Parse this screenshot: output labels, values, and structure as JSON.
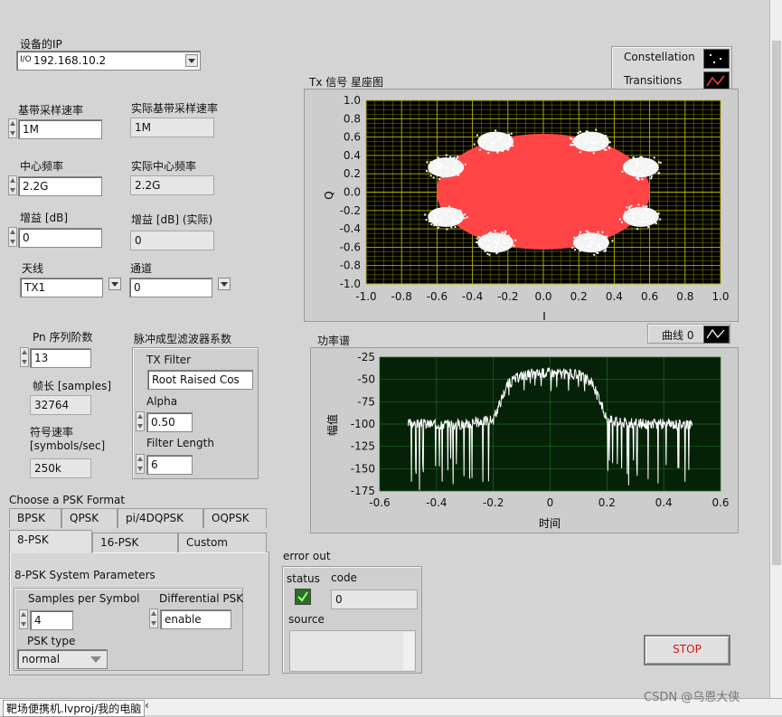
{
  "device_ip": {
    "label": "设备的IP",
    "value": "192.168.10.2"
  },
  "fields": {
    "baseband_rate": {
      "label": "基带采样速率",
      "value": "1M"
    },
    "actual_baseband_rate": {
      "label": "实际基带采样速率",
      "value": "1M"
    },
    "center_freq": {
      "label": "中心频率",
      "value": "2.2G"
    },
    "actual_center_freq": {
      "label": "实际中心频率",
      "value": "2.2G"
    },
    "gain": {
      "label": "增益 [dB]",
      "value": "0"
    },
    "actual_gain": {
      "label": "增益 [dB] (实际)",
      "value": "0"
    },
    "antenna": {
      "label": "天线",
      "value": "TX1"
    },
    "channel": {
      "label": "通道",
      "value": "0"
    },
    "pn_order": {
      "label": "Pn 序列阶数",
      "value": "13"
    },
    "frame_length": {
      "label": "帧长 [samples]",
      "value": "32764"
    },
    "symbol_rate": {
      "label": "符号速率\n[symbols/sec]",
      "label1": "符号速率",
      "label2": "[symbols/sec]",
      "value": "250k"
    }
  },
  "filter": {
    "group_label": "脉冲成型滤波器系数",
    "tx_filter_label": "TX Filter",
    "tx_filter_value": "Root Raised Cos",
    "alpha_label": "Alpha",
    "alpha_value": "0.50",
    "length_label": "Filter Length",
    "length_value": "6"
  },
  "psk": {
    "choose_label": "Choose a PSK Format",
    "tabs_row1": [
      "BPSK",
      "QPSK",
      "pi/4DQPSK",
      "OQPSK"
    ],
    "tabs_row2": [
      "8-PSK",
      "16-PSK",
      "Custom"
    ],
    "active_tab": "8-PSK",
    "params_title": "8-PSK System Parameters",
    "sps_label": "Samples per Symbol",
    "sps_value": "4",
    "diff_label": "Differential PSK",
    "diff_value": "enable",
    "type_label": "PSK type",
    "type_value": "normal"
  },
  "constellation": {
    "title": "Tx 信号 星座图",
    "legend": [
      {
        "name": "Constellation"
      },
      {
        "name": "Transitions"
      }
    ],
    "xlabel": "I",
    "ylabel": "Q",
    "ticks": [
      "-1.0",
      "-0.8",
      "-0.6",
      "-0.4",
      "-0.2",
      "0.0",
      "0.2",
      "0.4",
      "0.6",
      "0.8",
      "1.0"
    ],
    "yticks": [
      "1.0",
      "0.8",
      "0.6",
      "0.4",
      "0.2",
      "0.0",
      "-0.2",
      "-0.4",
      "-0.6",
      "-0.8",
      "-1.0"
    ],
    "colors": {
      "bg": "#000000",
      "grid": "#c8c800",
      "transition": "#ff4040",
      "points": "#ffffff"
    }
  },
  "chart_data": [
    {
      "type": "scatter",
      "title": "Tx 信号 星座图",
      "xlabel": "I",
      "ylabel": "Q",
      "xlim": [
        -1.0,
        1.0
      ],
      "ylim": [
        -1.0,
        1.0
      ],
      "series": [
        {
          "name": "Constellation",
          "points": [
            [
              0.55,
              0.27
            ],
            [
              0.27,
              0.55
            ],
            [
              -0.27,
              0.55
            ],
            [
              -0.55,
              0.27
            ],
            [
              -0.55,
              -0.27
            ],
            [
              -0.27,
              -0.55
            ],
            [
              0.27,
              -0.55
            ],
            [
              0.55,
              -0.27
            ]
          ]
        },
        {
          "name": "Transitions",
          "region": "filled ellipse radius ~0.6"
        }
      ]
    },
    {
      "type": "line",
      "title": "功率谱",
      "xlabel": "时间",
      "ylabel": "幅值",
      "xlim": [
        -0.6,
        0.6
      ],
      "ylim": [
        -175,
        -25
      ],
      "x": [
        -0.5,
        -0.3,
        -0.2,
        -0.15,
        -0.1,
        0.0,
        0.1,
        0.15,
        0.2,
        0.3,
        0.5
      ],
      "series": [
        {
          "name": "曲线 0",
          "values": [
            -100,
            -100,
            -95,
            -55,
            -45,
            -42,
            -45,
            -55,
            -95,
            -100,
            -100
          ]
        }
      ]
    }
  ],
  "spectrum": {
    "title": "功率谱",
    "legend": "曲线 0",
    "xlabel": "时间",
    "ylabel": "幅值",
    "xticks": [
      "-0.6",
      "-0.4",
      "-0.2",
      "0",
      "0.2",
      "0.4",
      "0.6"
    ],
    "yticks": [
      "-25",
      "-50",
      "-75",
      "-100",
      "-125",
      "-150",
      "-175"
    ]
  },
  "error": {
    "title": "error out",
    "status_label": "status",
    "code_label": "code",
    "code_value": "0",
    "source_label": "source",
    "source_value": ""
  },
  "stop_label": "STOP",
  "status_bar": "靶场便携机.lvproj/我的电脑",
  "watermark": "CSDN @乌恩大侠"
}
